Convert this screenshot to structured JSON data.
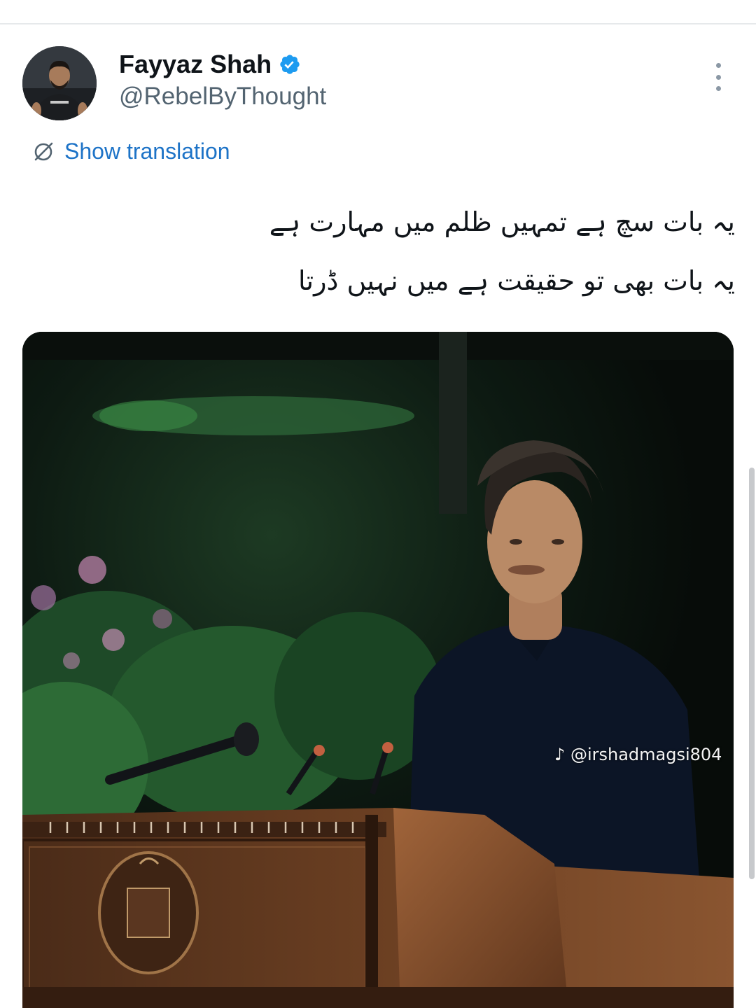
{
  "tweet": {
    "author": {
      "display_name": "Fayyaz Shah",
      "handle": "@RebelByThought",
      "verified": true,
      "verified_color": "#1d9bf0"
    },
    "show_translation_label": "Show translation",
    "text_lines": [
      "یہ بات سچ ہے تمہیں ظلم میں مہارت ہے",
      "یہ بات بھی تو حقیقت ہے میں نہیں ڈرتا"
    ],
    "media": {
      "watermark": "♪ @irshadmagsi804"
    }
  },
  "colors": {
    "link": "#1d73c7",
    "secondary_text": "#536471",
    "primary_text": "#0f1419"
  },
  "icons": {
    "more": "more-vertical-icon",
    "translate": "translate-icon",
    "verified": "verified-badge-icon"
  }
}
